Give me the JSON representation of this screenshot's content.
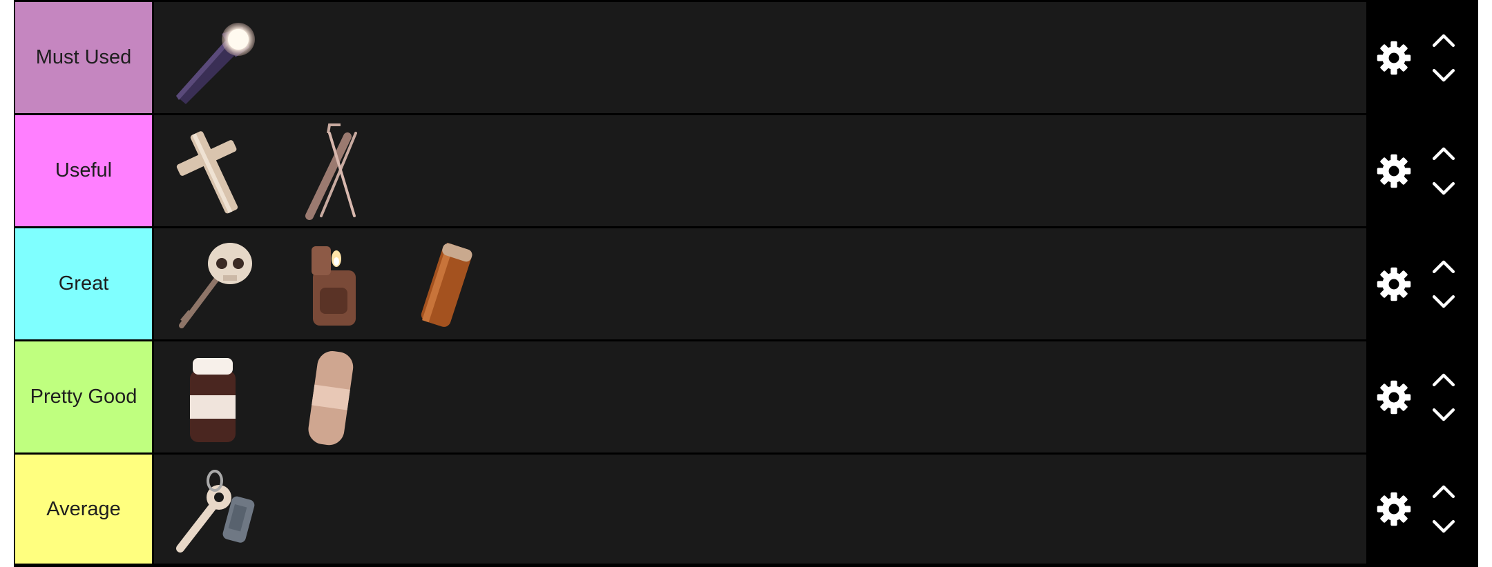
{
  "tiers": [
    {
      "label": "Must Used",
      "color": "#c586c0",
      "items": [
        "flashlight-icon"
      ]
    },
    {
      "label": "Useful",
      "color": "#ff7fff",
      "items": [
        "crucifix-icon",
        "lockpick-icon"
      ]
    },
    {
      "label": "Great",
      "color": "#7fffff",
      "items": [
        "skeleton-key-icon",
        "lighter-icon",
        "battery-icon"
      ]
    },
    {
      "label": "Pretty Good",
      "color": "#bfff7f",
      "items": [
        "vitamins-bottle-icon",
        "bandage-icon"
      ]
    },
    {
      "label": "Average",
      "color": "#ffff7f",
      "items": [
        "key-with-tag-icon"
      ]
    }
  ],
  "controls": {
    "settings_icon": "gear-icon",
    "move_up_icon": "chevron-up-icon",
    "move_down_icon": "chevron-down-icon"
  }
}
